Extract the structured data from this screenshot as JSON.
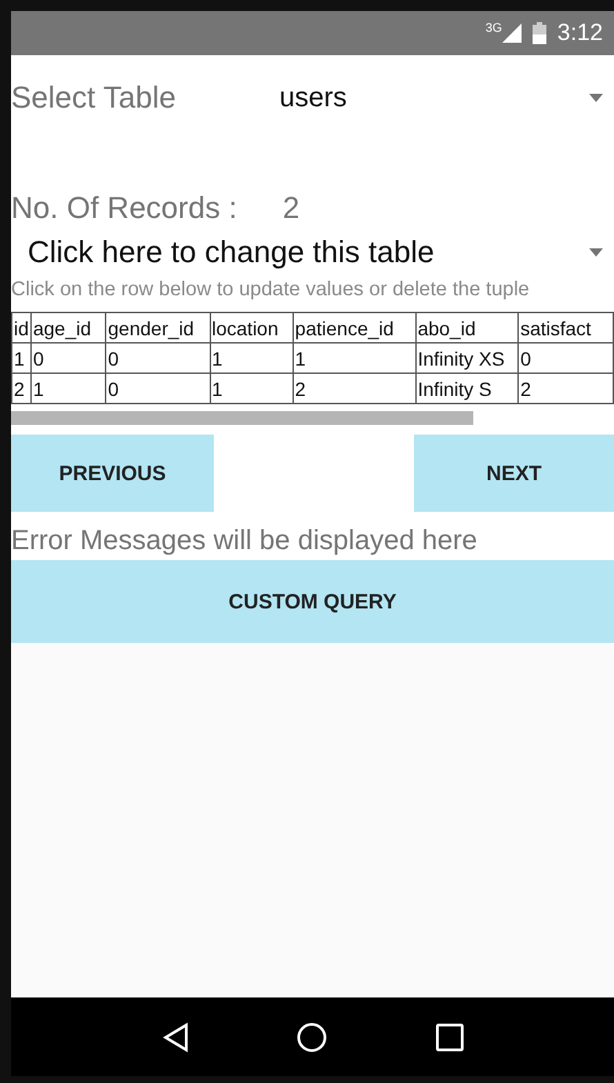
{
  "status_bar": {
    "network": "3G",
    "time": "3:12"
  },
  "table_select": {
    "label": "Select Table",
    "value": "users"
  },
  "records": {
    "label": "No. Of Records :",
    "value": "2"
  },
  "change_table": {
    "value": "Click here to change this table"
  },
  "hint": "Click on the row below to update values or delete the tuple",
  "table": {
    "columns": [
      "id",
      "age_id",
      "gender_id",
      "location",
      "patience_id",
      "abo_id",
      "satisfact"
    ],
    "rows": [
      [
        "1",
        "0",
        "0",
        "1",
        "1",
        "Infinity XS",
        "0"
      ],
      [
        "2",
        "1",
        "0",
        "1",
        "2",
        "Infinity S",
        "2"
      ]
    ]
  },
  "buttons": {
    "previous": "PREVIOUS",
    "next": "NEXT"
  },
  "error_message": "Error Messages will be displayed here",
  "custom_query": "CUSTOM QUERY"
}
